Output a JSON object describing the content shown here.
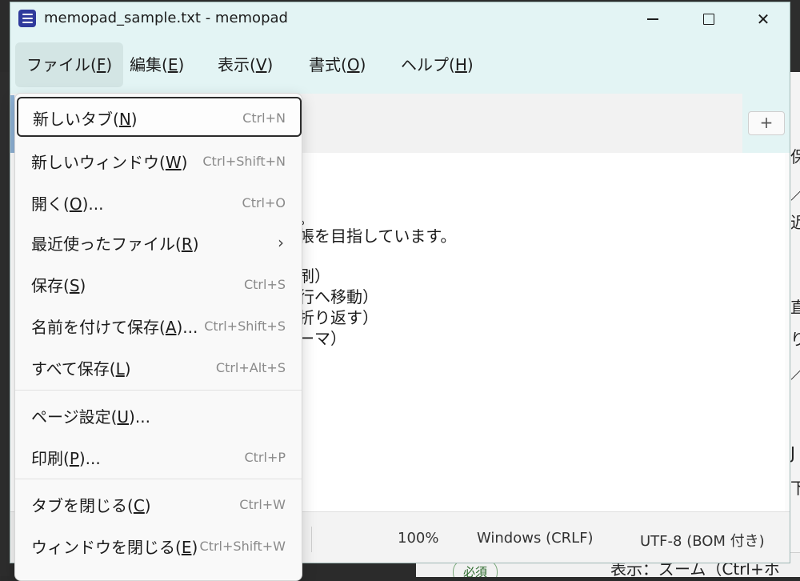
{
  "window": {
    "title": "memopad_sample.txt - memopad",
    "app_icon": "notepad-icon",
    "controls": {
      "minimize_icon": "minimize-icon",
      "maximize_icon": "maximize-icon",
      "close_icon": "close-icon",
      "close_glyph": "✕"
    }
  },
  "menubar": {
    "items": [
      {
        "text": "ファイル(",
        "key": "F",
        "tail": ")"
      },
      {
        "text": "編集(",
        "key": "E",
        "tail": ")"
      },
      {
        "text": "表示(",
        "key": "V",
        "tail": ")"
      },
      {
        "text": "書式(",
        "key": "O",
        "tail": ")"
      },
      {
        "text": "ヘルプ(",
        "key": "H",
        "tail": ")"
      }
    ]
  },
  "tabbar": {
    "new_tab_glyph": "+",
    "new_tab_icon": "plus-icon"
  },
  "editor": {
    "visible_fragments": [
      "。",
      "帳を目指しています。",
      "刷）",
      "行へ移動）",
      "折り返す）",
      "ーマ）"
    ]
  },
  "file_menu": {
    "items": [
      {
        "text": "新しいタブ(",
        "key": "N",
        "tail": ")",
        "shortcut": "Ctrl+N"
      },
      {
        "text": "新しいウィンドウ(",
        "key": "W",
        "tail": ")",
        "shortcut": "Ctrl+Shift+N"
      },
      {
        "text": "開く(",
        "key": "O",
        "tail": ")...",
        "shortcut": "Ctrl+O"
      },
      {
        "text": "最近使ったファイル(",
        "key": "R",
        "tail": ")",
        "shortcut": "",
        "submenu_icon": "chevron-right-icon",
        "submenu_glyph": "›"
      },
      {
        "text": "保存(",
        "key": "S",
        "tail": ")",
        "shortcut": "Ctrl+S"
      },
      {
        "text": "名前を付けて保存(",
        "key": "A",
        "tail": ")...",
        "shortcut": "Ctrl+Shift+S"
      },
      {
        "text": "すべて保存(",
        "key": "L",
        "tail": ")",
        "shortcut": "Ctrl+Alt+S"
      },
      {
        "text": "ページ設定(",
        "key": "U",
        "tail": ")...",
        "shortcut": ""
      },
      {
        "text": "印刷(",
        "key": "P",
        "tail": ")...",
        "shortcut": "Ctrl+P"
      },
      {
        "text": "タブを閉じる(",
        "key": "C",
        "tail": ")",
        "shortcut": "Ctrl+W"
      },
      {
        "text": "ウィンドウを閉じる(",
        "key": "E",
        "tail": ")",
        "shortcut": "Ctrl+Shift+W"
      }
    ]
  },
  "statusbar": {
    "zoom": "100%",
    "line_ending": "Windows (CRLF)",
    "encoding": "UTF-8 (BOM 付き)"
  },
  "background": {
    "right_glyphs": [
      "保",
      "／",
      "近",
      "直",
      "り",
      "／",
      "J",
      "下"
    ],
    "bottom_pill": "必須",
    "bottom_text": "表示：ズーム（Ctrl+ホ"
  }
}
